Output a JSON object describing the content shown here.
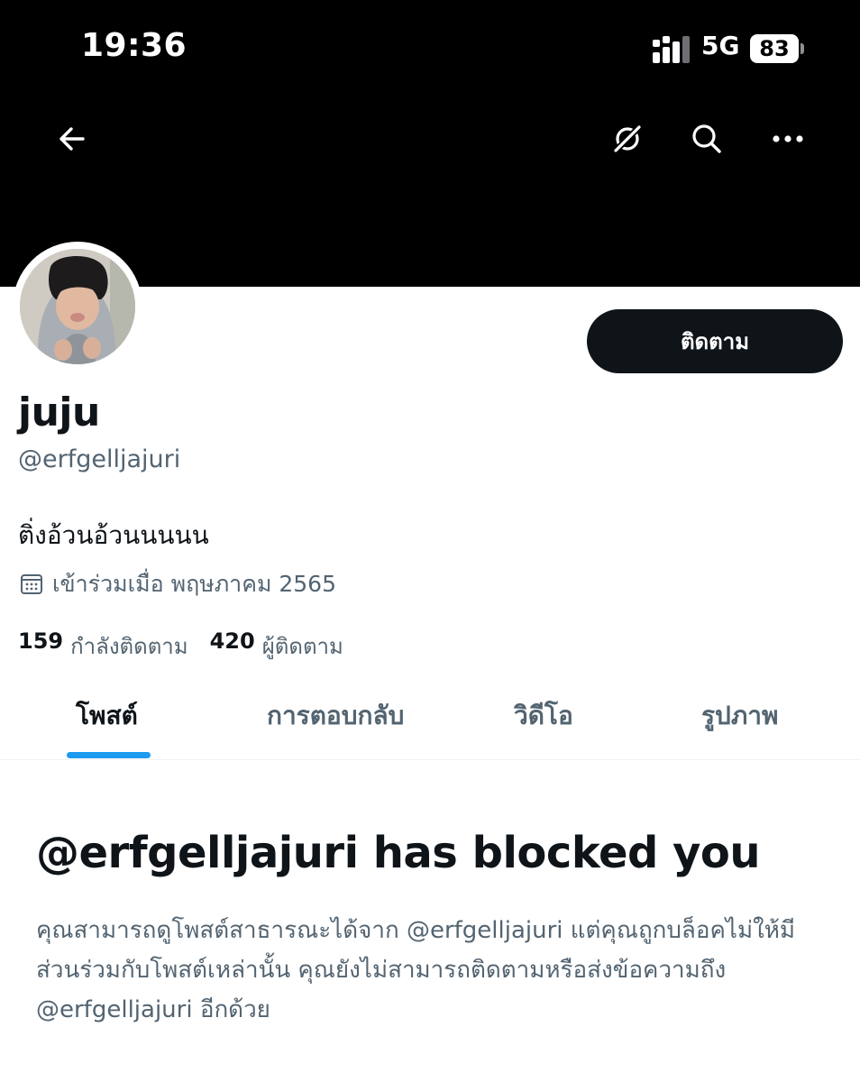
{
  "status_bar": {
    "time": "19:36",
    "network": "5G",
    "battery": "83"
  },
  "nav": {
    "icons": [
      "back-arrow-icon",
      "grok-icon",
      "search-icon",
      "more-icon"
    ]
  },
  "profile": {
    "follow_label": "ติดตาม",
    "display_name": "juju",
    "handle": "@erfgelljajuri",
    "bio": "ติ่งอ้วนอ้วนนนนน",
    "joined": "เข้าร่วมเมื่อ พฤษภาคม 2565",
    "following_count": "159",
    "following_label": "กำลังติดตาม",
    "followers_count": "420",
    "followers_label": "ผู้ติดตาม"
  },
  "tabs": [
    {
      "label": "โพสต์",
      "active": true
    },
    {
      "label": "การตอบกลับ",
      "active": false
    },
    {
      "label": "วิดีโอ",
      "active": false
    },
    {
      "label": "รูปภาพ",
      "active": false
    }
  ],
  "blocked": {
    "title": "@erfgelljajuri has blocked you",
    "message": "คุณสามารถดูโพสต์สาธารณะได้จาก @erfgelljajuri แต่คุณถูกบล็อคไม่ให้มีส่วนร่วมกับโพสต์เหล่านั้น คุณยังไม่สามารถติดตามหรือส่งข้อความถึง @erfgelljajuri อีกด้วย"
  },
  "colors": {
    "accent": "#1d9bf0",
    "text_primary": "#0f1419",
    "text_secondary": "#536471",
    "banner": "#000000"
  }
}
